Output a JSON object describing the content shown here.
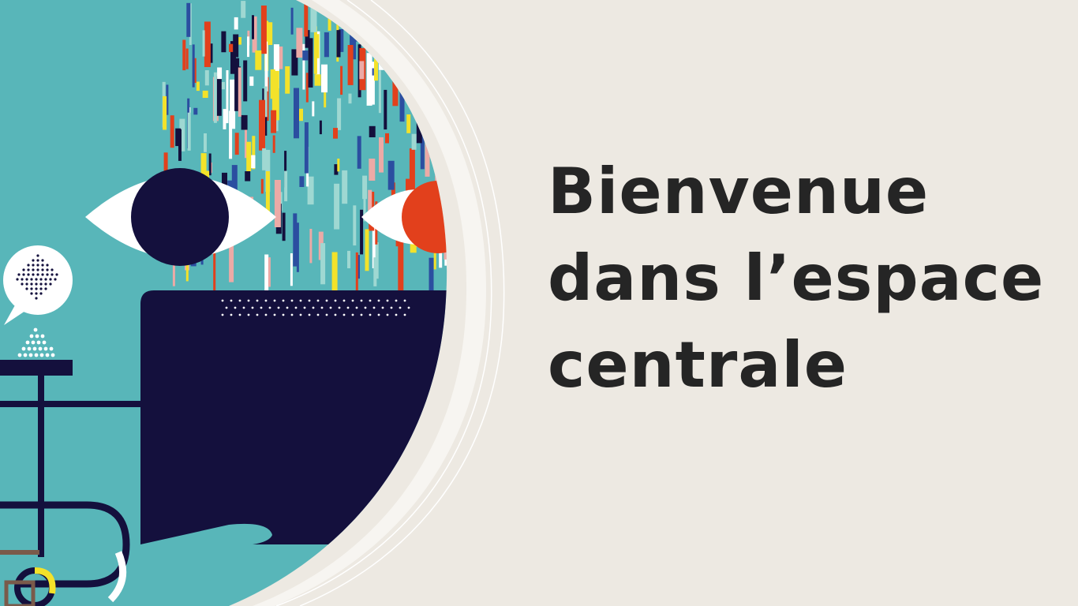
{
  "slide": {
    "title_lines": [
      "Bienvenue",
      "dans l’espace",
      "centrale"
    ]
  },
  "illustration": {
    "description_icons": [
      "eye-icon",
      "speech-bubble-icon",
      "hand-icon"
    ]
  },
  "colors": {
    "background": "#ede9e2",
    "teal": "#58b6b9",
    "navy": "#14103d",
    "red": "#e2401c",
    "yellow": "#f3e22a",
    "pink": "#ecaaa6",
    "title_text": "#252525"
  }
}
